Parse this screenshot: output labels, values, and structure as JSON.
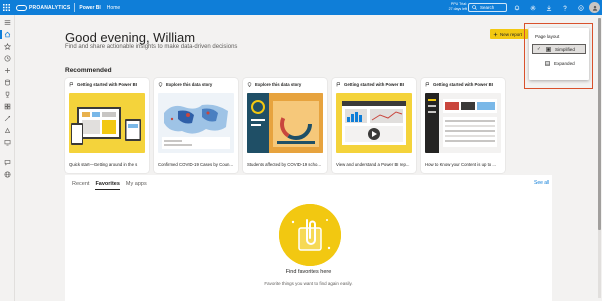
{
  "topbar": {
    "brand": "PROANALYTICS",
    "app_name": "Power BI",
    "breadcrumb": "Home",
    "trial_line1": "PPU Trial:",
    "trial_line2": "27 days left",
    "search_placeholder": "Search",
    "icons": [
      "bell-icon",
      "gear-icon",
      "download-icon",
      "help-icon",
      "feedback-icon"
    ],
    "accent": "#0f7ed8"
  },
  "left_rail": {
    "items": [
      "hamburger-icon",
      "home-icon",
      "star-icon",
      "clock-icon",
      "plus-icon",
      "cylinder-icon",
      "trophy-icon",
      "apps-icon",
      "workspace-icon",
      "pencil-icon",
      "deployment-icon",
      "monitor-icon",
      "chat-icon",
      "globe-icon"
    ]
  },
  "main": {
    "greeting": "Good evening, William",
    "subtitle": "Find and share actionable insights to make data-driven decisions",
    "new_report_label": "New report",
    "recommended_title": "Recommended",
    "cards": [
      {
        "header": "Getting started with Power BI",
        "caption": "Quick start—Getting around in the s",
        "icon": "flag-icon"
      },
      {
        "header": "Explore this data story",
        "caption": "Confirmed COVID-19 Cases by Coun...",
        "icon": "bulb-icon"
      },
      {
        "header": "Explore this data story",
        "caption": "Students affected by COVID-19 scho...",
        "icon": "bulb-icon"
      },
      {
        "header": "Getting started with Power BI",
        "caption": "View and understand a Power BI rep...",
        "icon": "flag-icon"
      },
      {
        "header": "Getting started with Power BI",
        "caption": "How to Know your Content is up to ...",
        "icon": "flag-icon"
      }
    ],
    "tabs": [
      "Recent",
      "Favorites",
      "My apps"
    ],
    "active_tab": "Favorites",
    "see_all": "See all",
    "empty_title": "Find favorites here",
    "empty_subtitle": "Favorite things you want to find again easily."
  },
  "popup": {
    "title": "Page layout",
    "options": [
      {
        "label": "Simplified",
        "selected": true
      },
      {
        "label": "Expanded",
        "selected": false
      }
    ],
    "outline_color": "#d9512c"
  }
}
